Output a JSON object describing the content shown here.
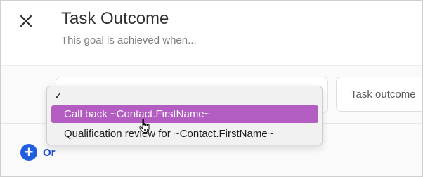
{
  "header": {
    "close_icon": "close-icon",
    "title": "Task Outcome",
    "subtitle": "This goal is achieved when..."
  },
  "outcome_field": {
    "placeholder": "Task outcome"
  },
  "dropdown": {
    "checkmark": "✓",
    "selected_index": 0,
    "options": [
      "Call back ~Contact.FirstName~",
      "Qualification review for ~Contact.FirstName~"
    ],
    "highlight_color": "#b35cc1"
  },
  "add_or": {
    "icon": "plus-circle-icon",
    "icon_glyph": "+",
    "label": "Or",
    "color": "#1f5fde"
  },
  "cursor_icon": "hand-pointer-icon"
}
